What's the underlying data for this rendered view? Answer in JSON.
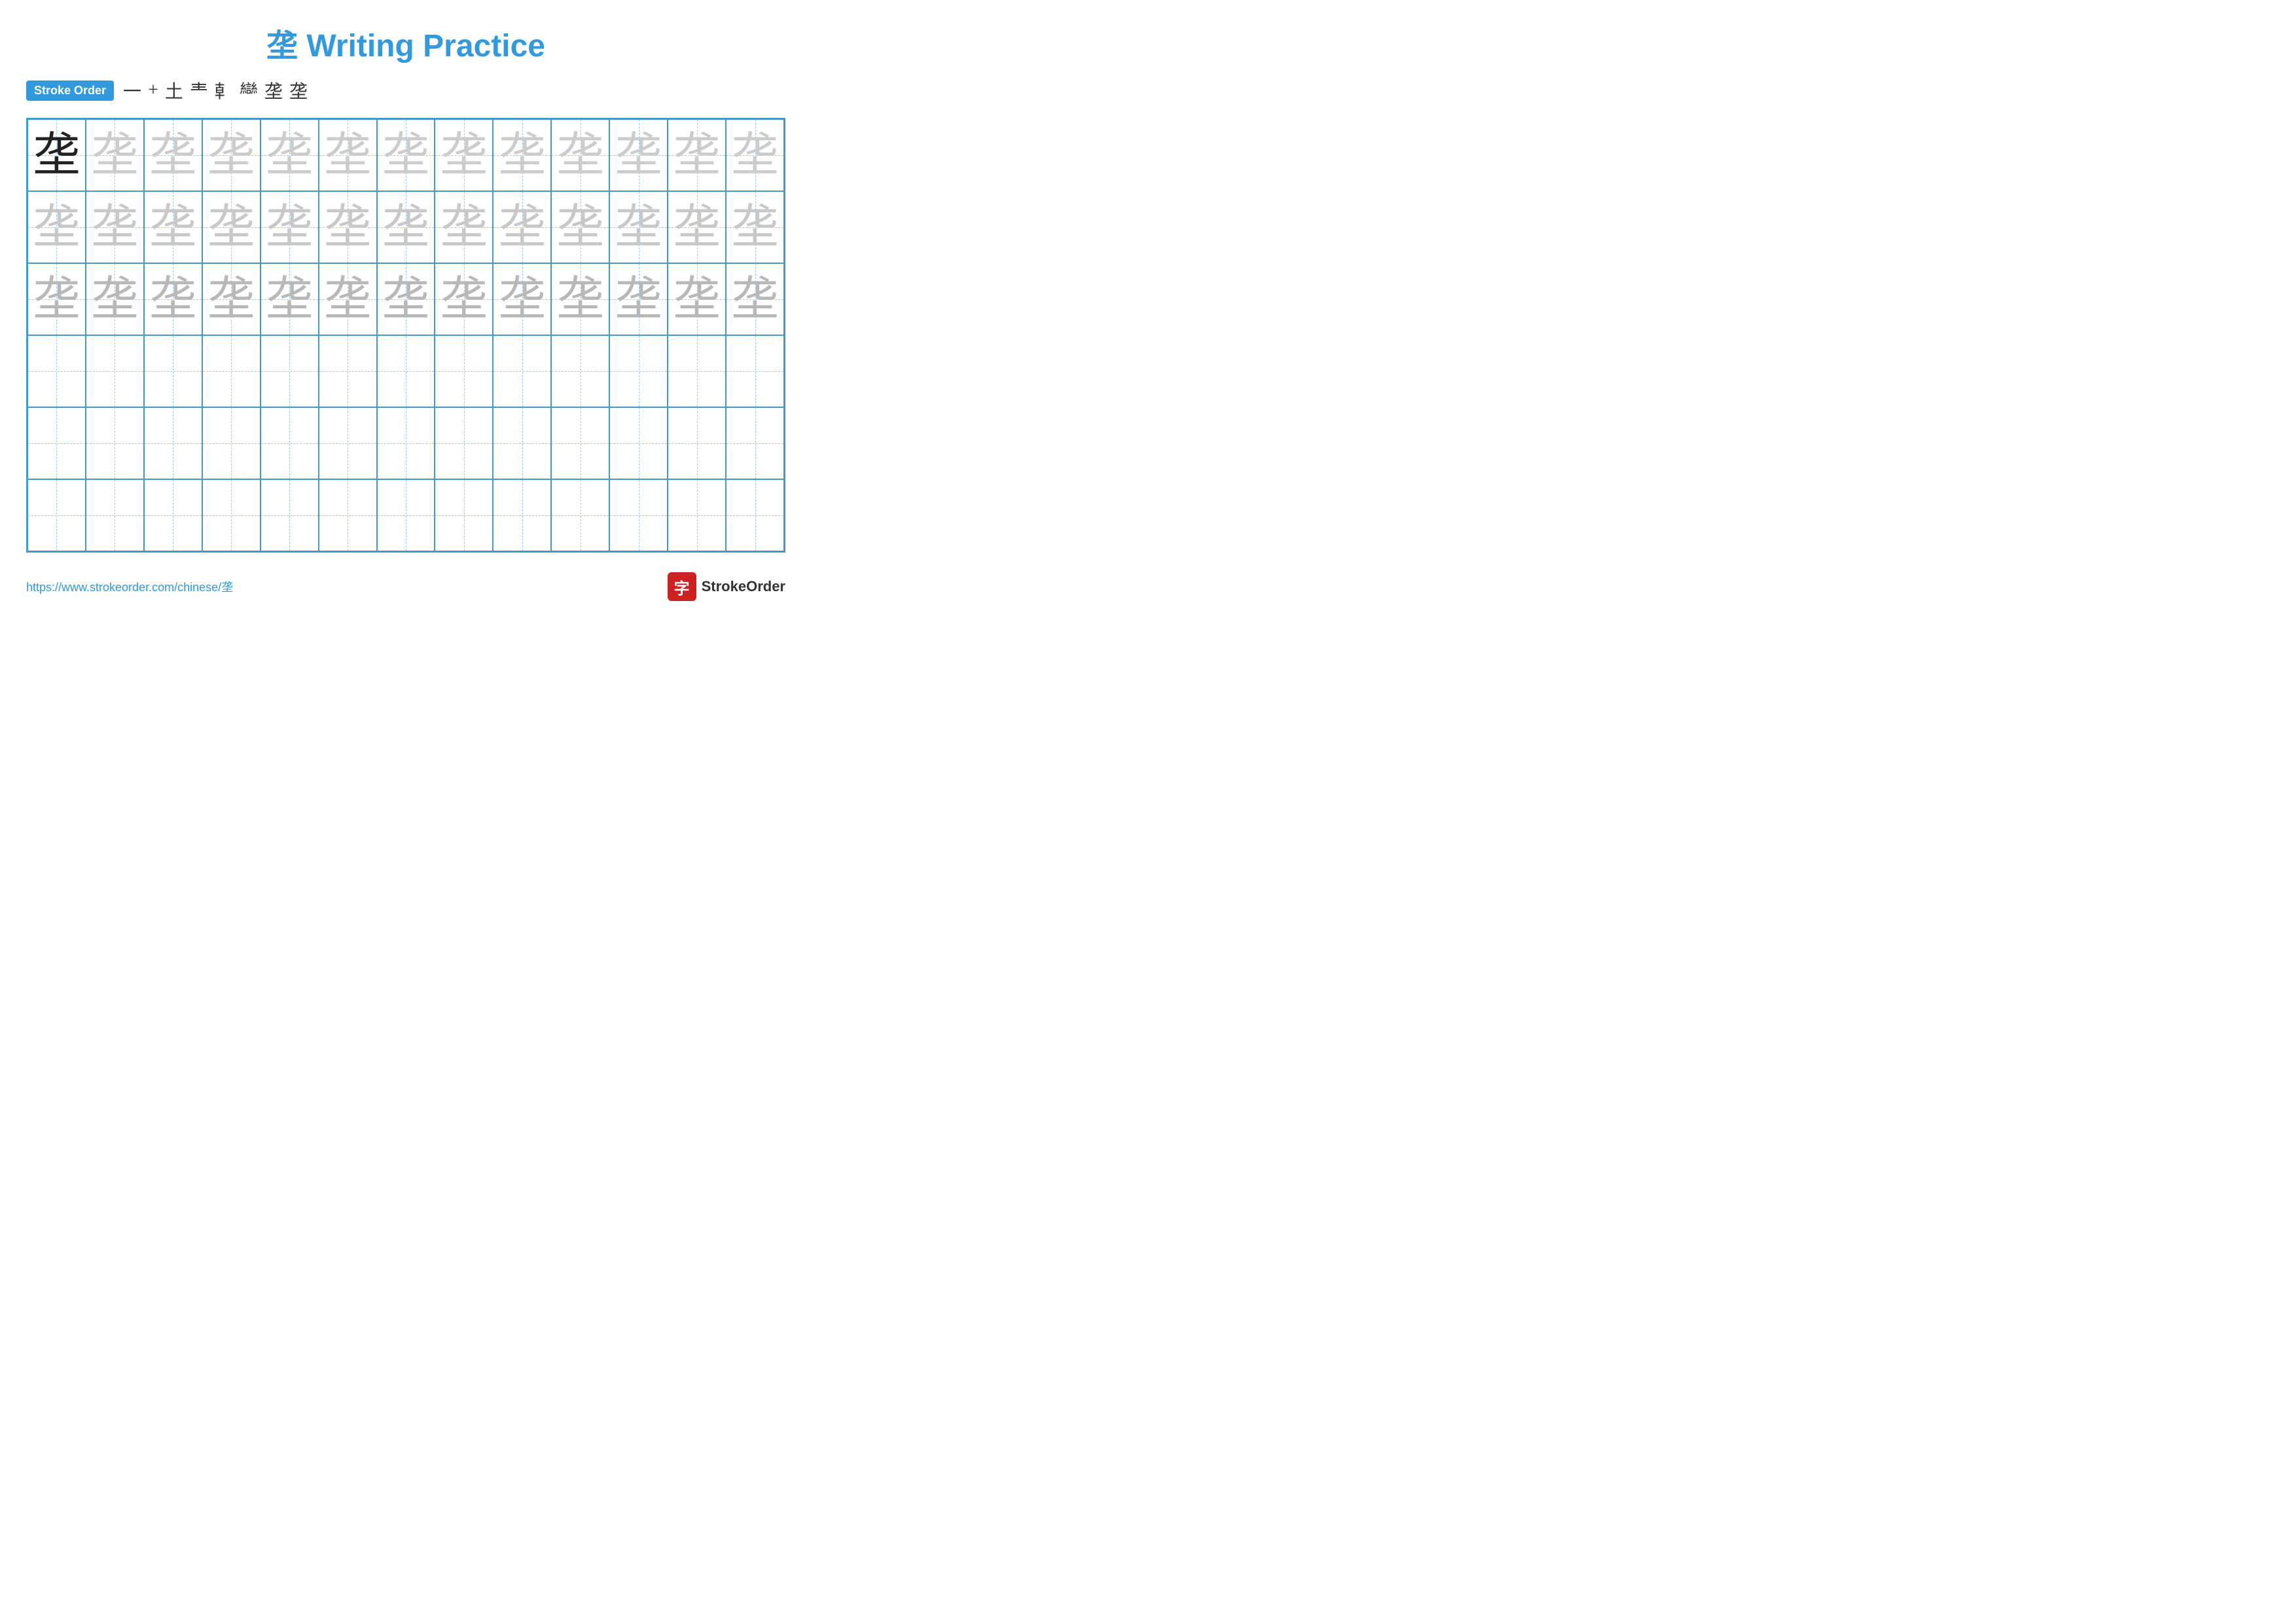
{
  "page": {
    "title": "垄 Writing Practice",
    "title_char": "垄",
    "title_text": " Writing Practice"
  },
  "stroke_order": {
    "badge_label": "Stroke Order",
    "strokes": [
      "一",
      "+",
      "土",
      "龶",
      "龺",
      "龻",
      "垄",
      "垄"
    ]
  },
  "grid": {
    "rows": 6,
    "cols": 13,
    "char": "垄"
  },
  "footer": {
    "url": "https://www.strokeorder.com/chinese/垄",
    "brand_name": "StrokeOrder",
    "brand_icon": "字"
  }
}
